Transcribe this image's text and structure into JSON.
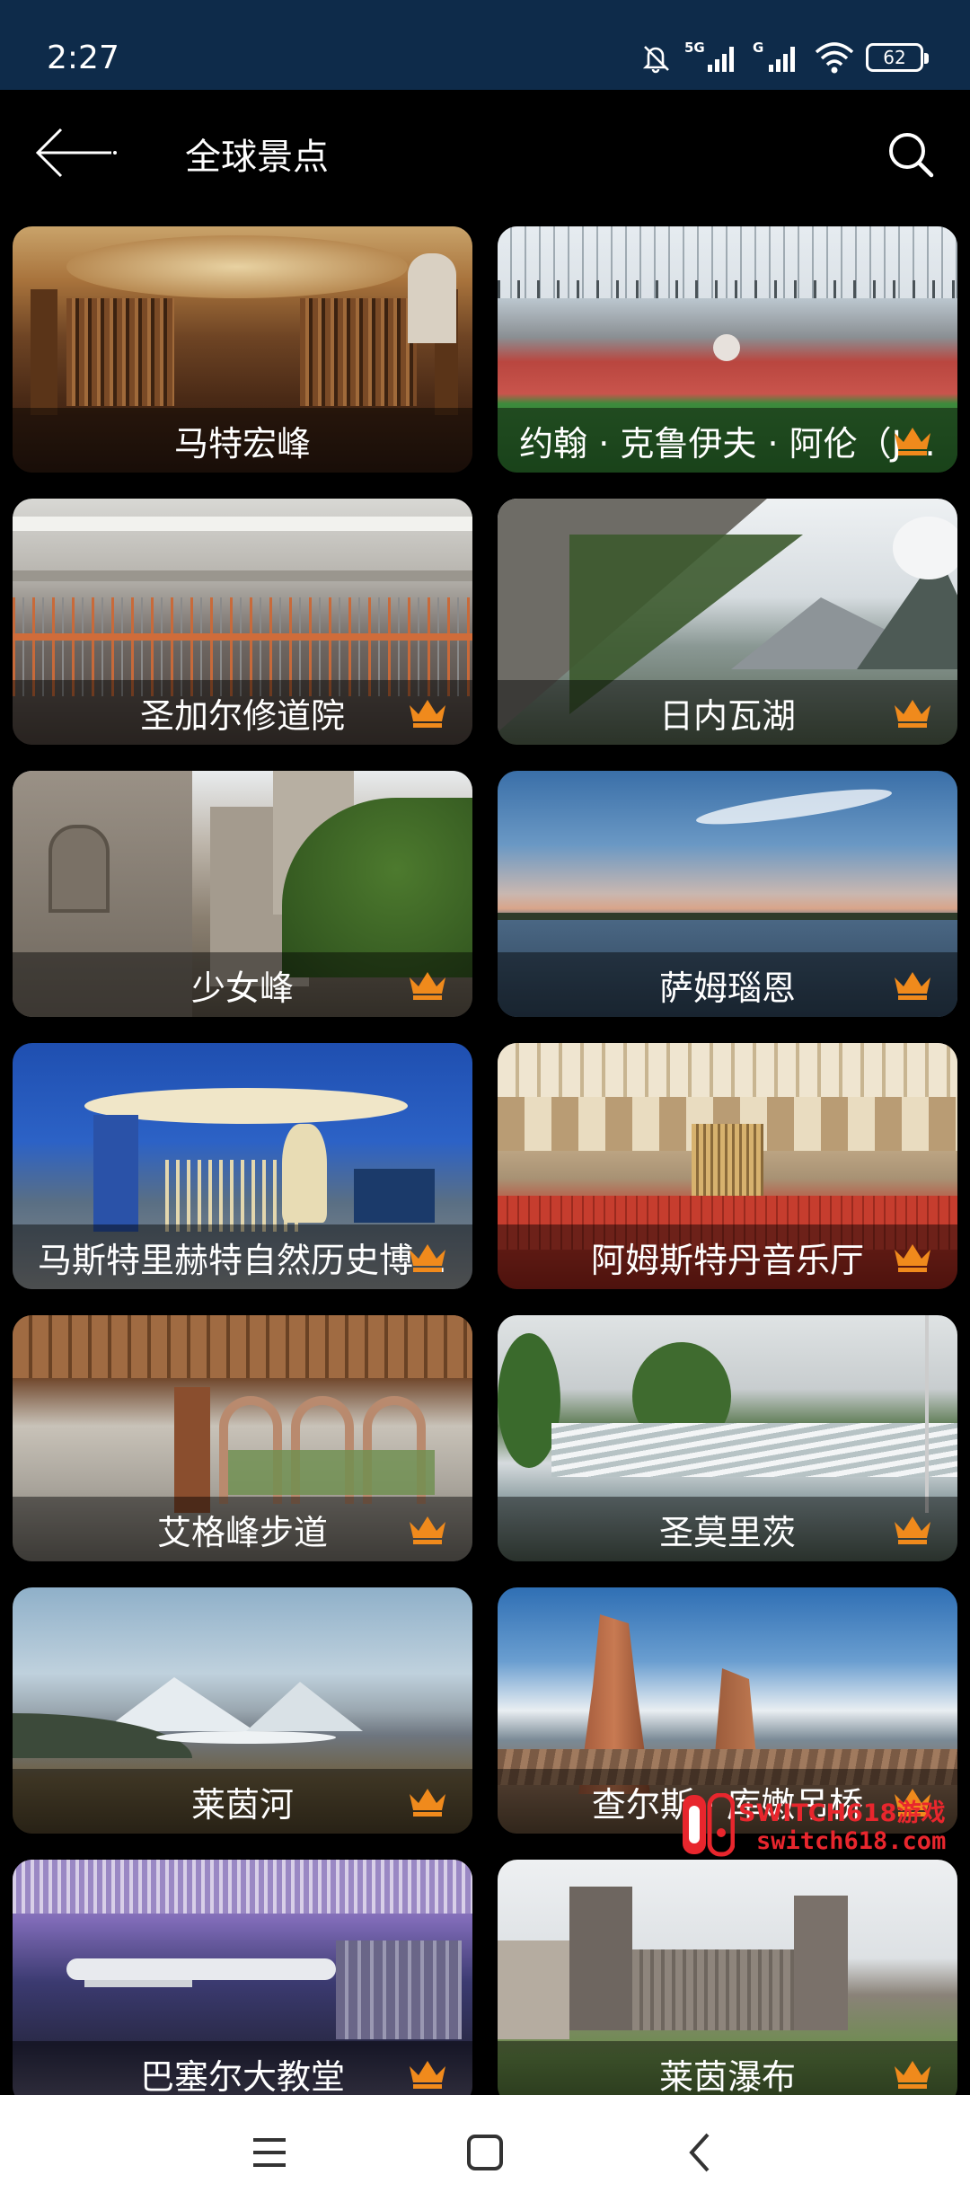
{
  "status_bar": {
    "time": "2:27",
    "signal_label": "5G",
    "battery": "62"
  },
  "header": {
    "title": "全球景点"
  },
  "places": [
    {
      "name": "马特宏峰",
      "premium": false
    },
    {
      "name": "约翰 · 克鲁伊夫 · 阿伦（J…",
      "premium": true
    },
    {
      "name": "圣加尔修道院",
      "premium": true
    },
    {
      "name": "日内瓦湖",
      "premium": true
    },
    {
      "name": "少女峰",
      "premium": true
    },
    {
      "name": "萨姆瑙恩",
      "premium": true
    },
    {
      "name": "马斯特里赫特自然历史博…",
      "premium": true
    },
    {
      "name": "阿姆斯特丹音乐厅",
      "premium": true
    },
    {
      "name": "艾格峰步道",
      "premium": true
    },
    {
      "name": "圣莫里茨",
      "premium": true
    },
    {
      "name": "莱茵河",
      "premium": true
    },
    {
      "name": "查尔斯 · 库嫩吊桥",
      "premium": true
    },
    {
      "name": "巴塞尔大教堂",
      "premium": true
    },
    {
      "name": "莱茵瀑布",
      "premium": true
    }
  ],
  "watermark": {
    "title": "SWITCH618游戏",
    "url": "switch618.com"
  },
  "icons": {
    "back": "back-arrow-icon",
    "search": "search-icon",
    "premium": "crown-icon",
    "menu": "menu-icon",
    "home": "home-icon",
    "nav_back": "chevron-left-icon"
  },
  "colors": {
    "status_bar": "#0e2b4a",
    "crown": "#f08a1c",
    "watermark": "#e8262d"
  }
}
